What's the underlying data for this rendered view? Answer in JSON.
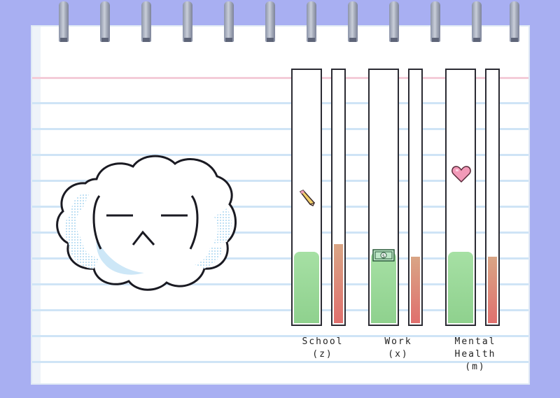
{
  "meters": [
    {
      "name": "School",
      "key": "(z)",
      "icon": "pencil-icon",
      "level": 0.28,
      "stress": 0.31
    },
    {
      "name": "Work",
      "key": "(x)",
      "icon": "money-icon",
      "level": 0.28,
      "stress": 0.26
    },
    {
      "name": "Mental Health",
      "name_line1": "Mental",
      "name_line2": "Health",
      "key": "(m)",
      "icon": "heart-icon",
      "level": 0.28,
      "stress": 0.26
    }
  ],
  "labels": {
    "school": "School",
    "school_key": "(z)",
    "work": "Work",
    "work_key": "(x)",
    "mental_line1": "Mental",
    "mental_line2": "Health",
    "mental_key": "(m)"
  },
  "colors": {
    "background": "#a8aff2",
    "paper": "#ffffff",
    "rule": "#cfe4f6",
    "red_rule": "#f4ccd8",
    "meter_green": "#97d796",
    "meter_red": "#e0706e",
    "cloud_shade": "#cde7f7"
  },
  "character": {
    "icon": "cloud-face-icon"
  }
}
